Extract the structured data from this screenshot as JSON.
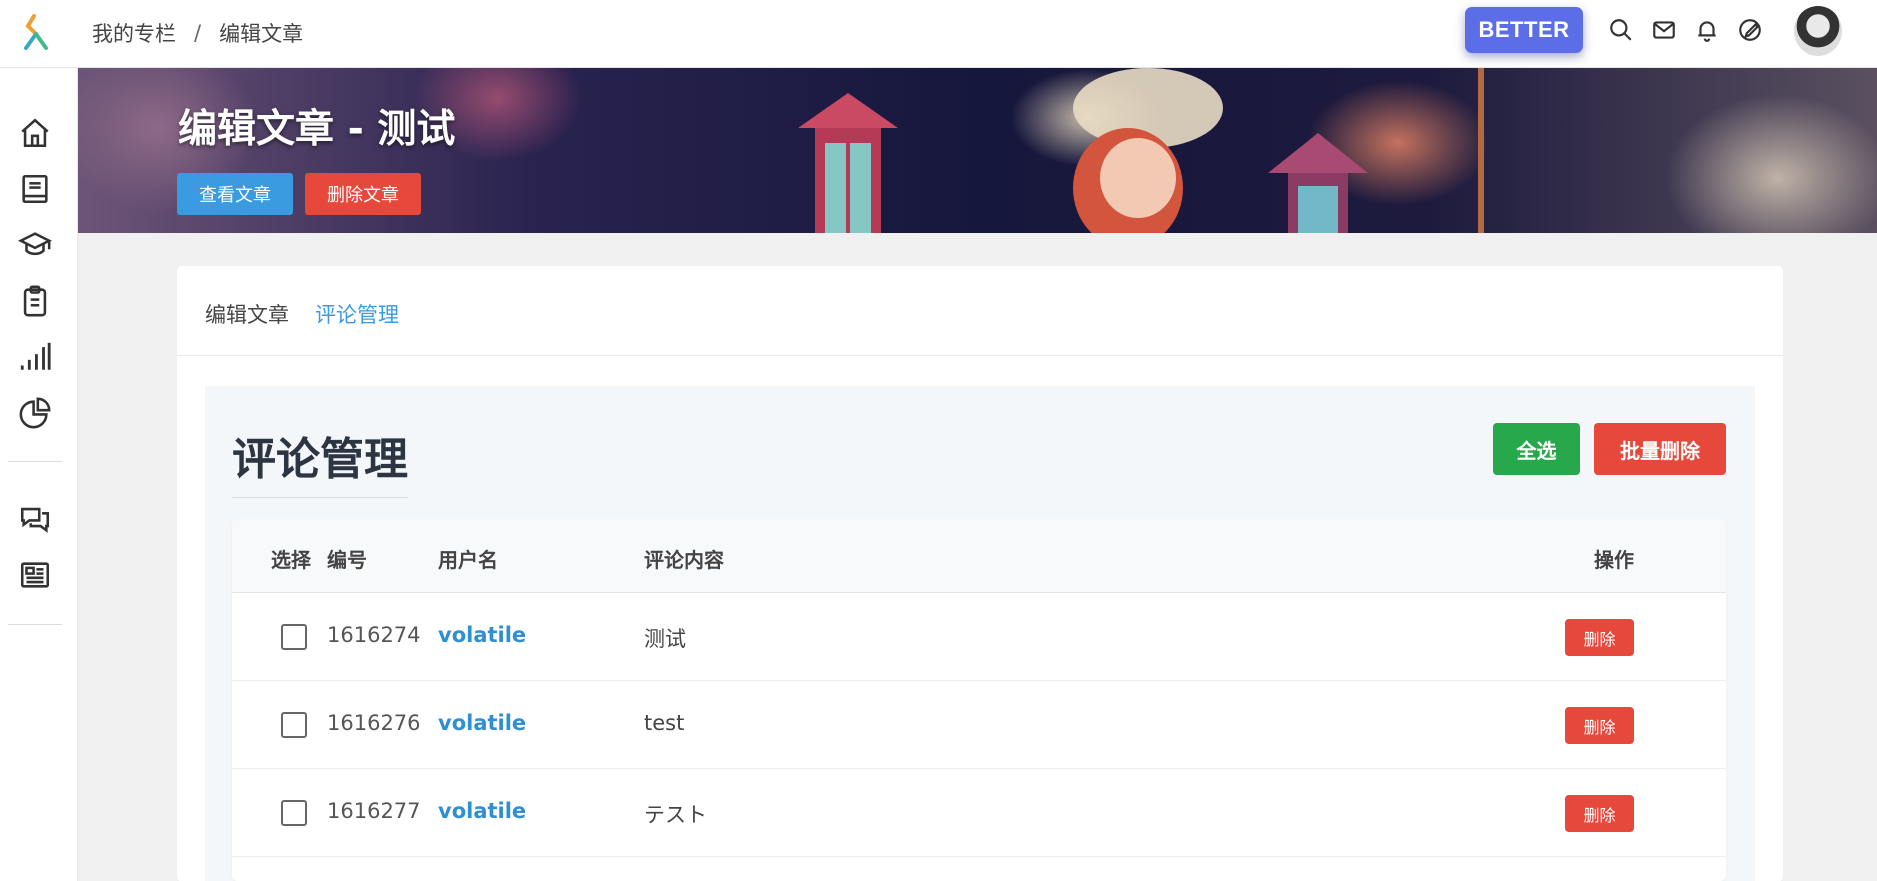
{
  "header": {
    "breadcrumb": [
      "我的专栏",
      "/",
      "编辑文章"
    ],
    "better_label": "BETTER",
    "icons": [
      "search-icon",
      "mail-icon",
      "bell-icon",
      "edit-icon"
    ]
  },
  "sidebar": {
    "items": [
      "home-icon",
      "book-icon",
      "graduation-cap-icon",
      "clipboard-icon",
      "signal-bars-icon",
      "pie-chart-icon",
      "chat-icon",
      "newspaper-icon"
    ]
  },
  "banner": {
    "title": "编辑文章 - 测试",
    "view_label": "查看文章",
    "delete_label": "删除文章"
  },
  "tabs": {
    "edit": "编辑文章",
    "comments": "评论管理",
    "active": "comments"
  },
  "panel": {
    "title": "评论管理",
    "select_all": "全选",
    "bulk_delete": "批量删除"
  },
  "table": {
    "headers": {
      "select": "选择",
      "id": "编号",
      "username": "用户名",
      "content": "评论内容",
      "action": "操作"
    },
    "rows": [
      {
        "id": "1616274",
        "username": "volatile",
        "content": "测试",
        "action": "删除"
      },
      {
        "id": "1616276",
        "username": "volatile",
        "content": "test",
        "action": "删除"
      },
      {
        "id": "1616277",
        "username": "volatile",
        "content": "テスト",
        "action": "删除"
      }
    ]
  },
  "colors": {
    "primary": "#3a9be0",
    "danger": "#e6483b",
    "success": "#27a84a",
    "better": "#5b6ee8"
  }
}
